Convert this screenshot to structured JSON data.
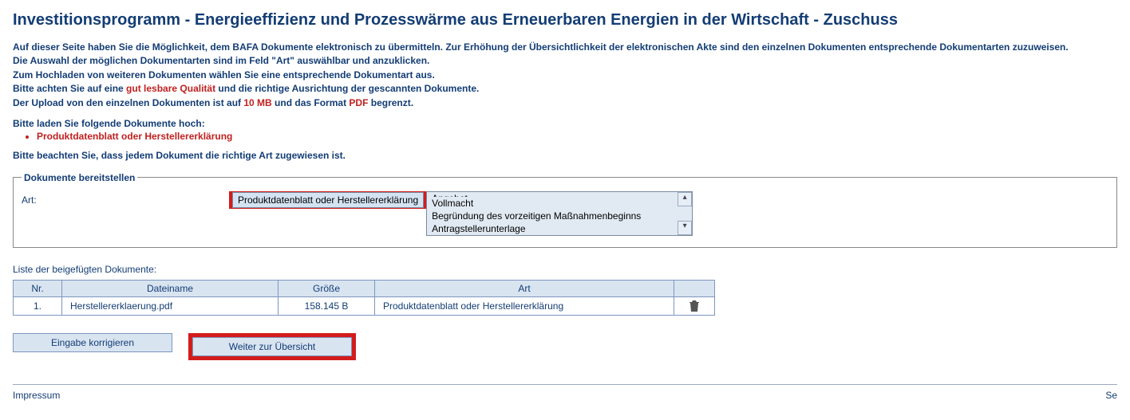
{
  "title": "Investitionsprogramm - Energieeffizienz und Prozesswärme aus Erneuerbaren Energien in der Wirtschaft - Zuschuss",
  "intro": {
    "p1a": "Auf dieser Seite haben Sie die Möglichkeit, dem BAFA Dokumente elektronisch zu übermitteln. Zur Erhöhung der Übersichtlichkeit der elektronischen Akte sind den einzelnen Dokumenten entsprechende Dokumentarten zuzuweisen.",
    "p2": "Die Auswahl der möglichen Dokumentarten sind im Feld \"Art\" auswählbar und anzuklicken.",
    "p3": "Zum Hochladen von weiteren Dokumenten wählen Sie eine entsprechende Dokumentart aus.",
    "p4a": "Bitte achten Sie auf eine ",
    "p4b": "gut lesbare Qualität",
    "p4c": " und die richtige Ausrichtung der gescannten Dokumente.",
    "p5a": "Der Upload von den einzelnen Dokumenten ist auf ",
    "p5b": "10 MB",
    "p5c": " und das Format ",
    "p5d": "PDF",
    "p5e": " begrenzt."
  },
  "required": {
    "lead": "Bitte laden Sie folgende Dokumente hoch:",
    "items": [
      "Produktdatenblatt oder Herstellererklärung"
    ]
  },
  "note": "Bitte beachten Sie, dass jedem Dokument die richtige Art zugewiesen ist.",
  "fieldset": {
    "legend": "Dokumente bereitstellen",
    "art_label": "Art:",
    "selected": "Produktdatenblatt oder Herstellererklärung",
    "options": [
      "Angebot",
      "Vollmacht",
      "Begründung des vorzeitigen Maßnahmenbeginns",
      "Antragstellerunterlage"
    ]
  },
  "list_caption": "Liste der beigefügten Dokumente:",
  "table": {
    "headers": {
      "nr": "Nr.",
      "name": "Dateiname",
      "size": "Größe",
      "type": "Art",
      "actions": ""
    },
    "rows": [
      {
        "nr": "1.",
        "name": "Herstellererklaerung.pdf",
        "size": "158.145 B",
        "type": "Produktdatenblatt oder Herstellererklärung"
      }
    ]
  },
  "buttons": {
    "back": "Eingabe korrigieren",
    "next": "Weiter zur Übersicht"
  },
  "footer": {
    "left": "Impressum",
    "right": "Se"
  }
}
